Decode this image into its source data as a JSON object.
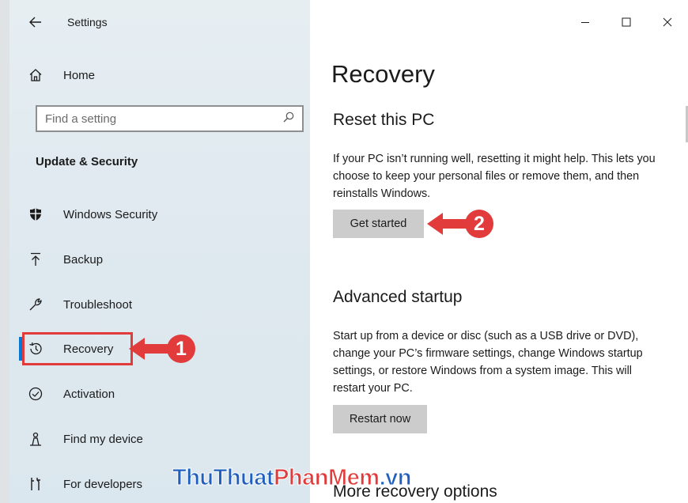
{
  "app": {
    "title": "Settings"
  },
  "sidebar": {
    "home_label": "Home",
    "search_placeholder": "Find a setting",
    "section_heading": "Update & Security",
    "items": [
      {
        "label": "Windows Security",
        "icon": "shield-icon"
      },
      {
        "label": "Backup",
        "icon": "backup-arrow-icon"
      },
      {
        "label": "Troubleshoot",
        "icon": "wrench-icon"
      },
      {
        "label": "Recovery",
        "icon": "history-icon",
        "selected": true
      },
      {
        "label": "Activation",
        "icon": "check-circle-icon"
      },
      {
        "label": "Find my device",
        "icon": "person-pin-icon"
      },
      {
        "label": "For developers",
        "icon": "developer-tools-icon"
      }
    ]
  },
  "window_controls": {
    "minimize": "minimize-icon",
    "maximize": "maximize-icon",
    "close": "close-icon"
  },
  "main": {
    "page_title": "Recovery",
    "reset": {
      "heading": "Reset this PC",
      "description": "If your PC isn’t running well, resetting it might help. This lets you choose to keep your personal files or remove them, and then reinstalls Windows.",
      "button_label": "Get started"
    },
    "advanced": {
      "heading": "Advanced startup",
      "description": "Start up from a device or disc (such as a USB drive or DVD), change your PC’s firmware settings, change Windows startup settings, or restore Windows from a system image. This will restart your PC.",
      "button_label": "Restart now"
    },
    "more": {
      "heading": "More recovery options"
    }
  },
  "annotations": {
    "step1": "1",
    "step2": "2"
  },
  "watermark": {
    "part1": "ThuThuat",
    "part2": "PhanMem",
    "part3": ".vn"
  },
  "colors": {
    "accent": "#0078d7",
    "annotation_red": "#e23b3b",
    "button_gray": "#cccccc"
  }
}
